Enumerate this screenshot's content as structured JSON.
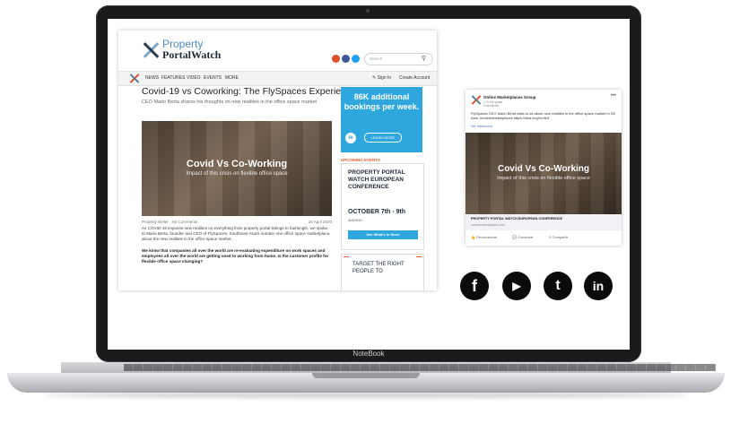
{
  "laptop": {
    "brand": "NoteBook"
  },
  "site": {
    "logo": {
      "line1": "Property",
      "line2": "PortalWatch"
    },
    "search_placeholder": "Search",
    "nav": {
      "items": [
        "NEWS",
        "FEATURES",
        "VIDEO",
        "EVENTS",
        "MORE"
      ],
      "sign_in": "Sign In",
      "create_account": "Create Account"
    },
    "article": {
      "title": "Covid-19 vs Coworking: The FlySpaces Experience",
      "subtitle": "CEO Mario Berta shares his thoughts on new realities in the office space market",
      "hero_title": "Covid Vs Co-Working",
      "hero_subtitle": "Impact of this crisis on flexible office space",
      "byline_author": "Property Beller",
      "byline_comments": "No Comments",
      "byline_date": "15 April 2020",
      "para1": "As COVID-19 imposes new realities on everything from property portal listings to hairlength, we spoke to Mario Berta, founder and CEO of FlySpaces, Southeast Asia's number one office space marketplace, about the new realities in the office space market.",
      "para2": "We know that companies all over the world are re-evaluating expenditure on work spaces and employees all over the world are getting used to working from home. Is the customer profile for flexible office space changing?"
    },
    "ad1": {
      "text": "86K additional bookings per week.",
      "logo": "ie",
      "button": "LEARN MORE"
    },
    "upcoming_label": "UPCOMING EVENTS",
    "event": {
      "title": "PROPERTY PORTAL WATCH EUROPEAN CONFERENCE",
      "date": "OCTOBER 7th - 9th",
      "city": "MADRID",
      "button": "See What's In Store"
    },
    "ad2": {
      "text": "TARGET THE RIGHT PEOPLE TO"
    }
  },
  "facebook": {
    "page_name": "Online Marketplaces Group",
    "likes": "170 Me gusta",
    "time": "2 semanas",
    "text": "FlySpaces CEO Mario Berta talks to us about new realities in the office space market in SE Asia. #onlinemarketplaces https://lnkd.in/gXcr9s3",
    "translate": "Ver traducción",
    "image_title": "Covid Vs Co-Working",
    "image_subtitle": "Impact of this crisis on flexible office space",
    "link_title": "PROPERTY PORTAL WATCH EUROPEAN CONFERENCE",
    "link_url": "onlinemarketplaces.com",
    "actions": [
      "Recomendar",
      "Comentar",
      "Compartir"
    ]
  },
  "social": {
    "icons": [
      "facebook-icon",
      "youtube-icon",
      "twitter-icon",
      "linkedin-icon"
    ],
    "glyphs": [
      "f",
      "▶",
      "t",
      "in"
    ]
  },
  "colors": {
    "accent_blue": "#2ea6de",
    "accent_orange": "#e06030",
    "dark": "#1c2a3a"
  }
}
